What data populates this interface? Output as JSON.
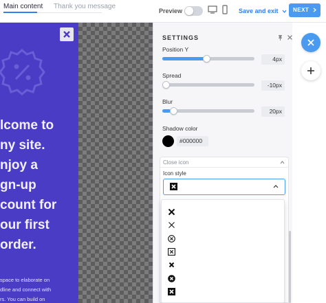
{
  "tabs": [
    {
      "label": "Main content",
      "active": true
    },
    {
      "label": "Thank you message",
      "active": false
    }
  ],
  "toolbar": {
    "preview_label": "Preview",
    "preview_enabled": false,
    "save_exit_label": "Save and exit",
    "next_label": "NEXT"
  },
  "popup": {
    "background_color": "#4a3cc4",
    "headline_lines": [
      "lcome to",
      "ny site.",
      "njoy a",
      "gn-up",
      "count for",
      "our first",
      "order."
    ],
    "body_lines": [
      "space to elaborate on",
      "dline and connect with",
      "rs. You can build on"
    ]
  },
  "settings": {
    "title": "SETTINGS",
    "position_y": {
      "label": "Position Y",
      "value": "4px",
      "level": 0.48
    },
    "spread": {
      "label": "Spread",
      "value": "-10px",
      "level": 0.0
    },
    "blur": {
      "label": "Blur",
      "value": "20px",
      "level": 0.09
    },
    "shadow_color": {
      "label": "Shadow color",
      "value": "#000000"
    },
    "close_icon": {
      "section_title": "Close icon",
      "icon_style_label": "Icon style",
      "selected_icon": "x-square-filled-icon",
      "options": [
        "x-bold-icon",
        "x-thin-icon",
        "x-circle-outline-icon",
        "x-square-outline-icon",
        "x-small-bold-icon",
        "x-circle-filled-icon",
        "x-square-filled-icon"
      ]
    }
  },
  "colors": {
    "accent": "#4a9bef",
    "popup": "#4a3cc4"
  }
}
